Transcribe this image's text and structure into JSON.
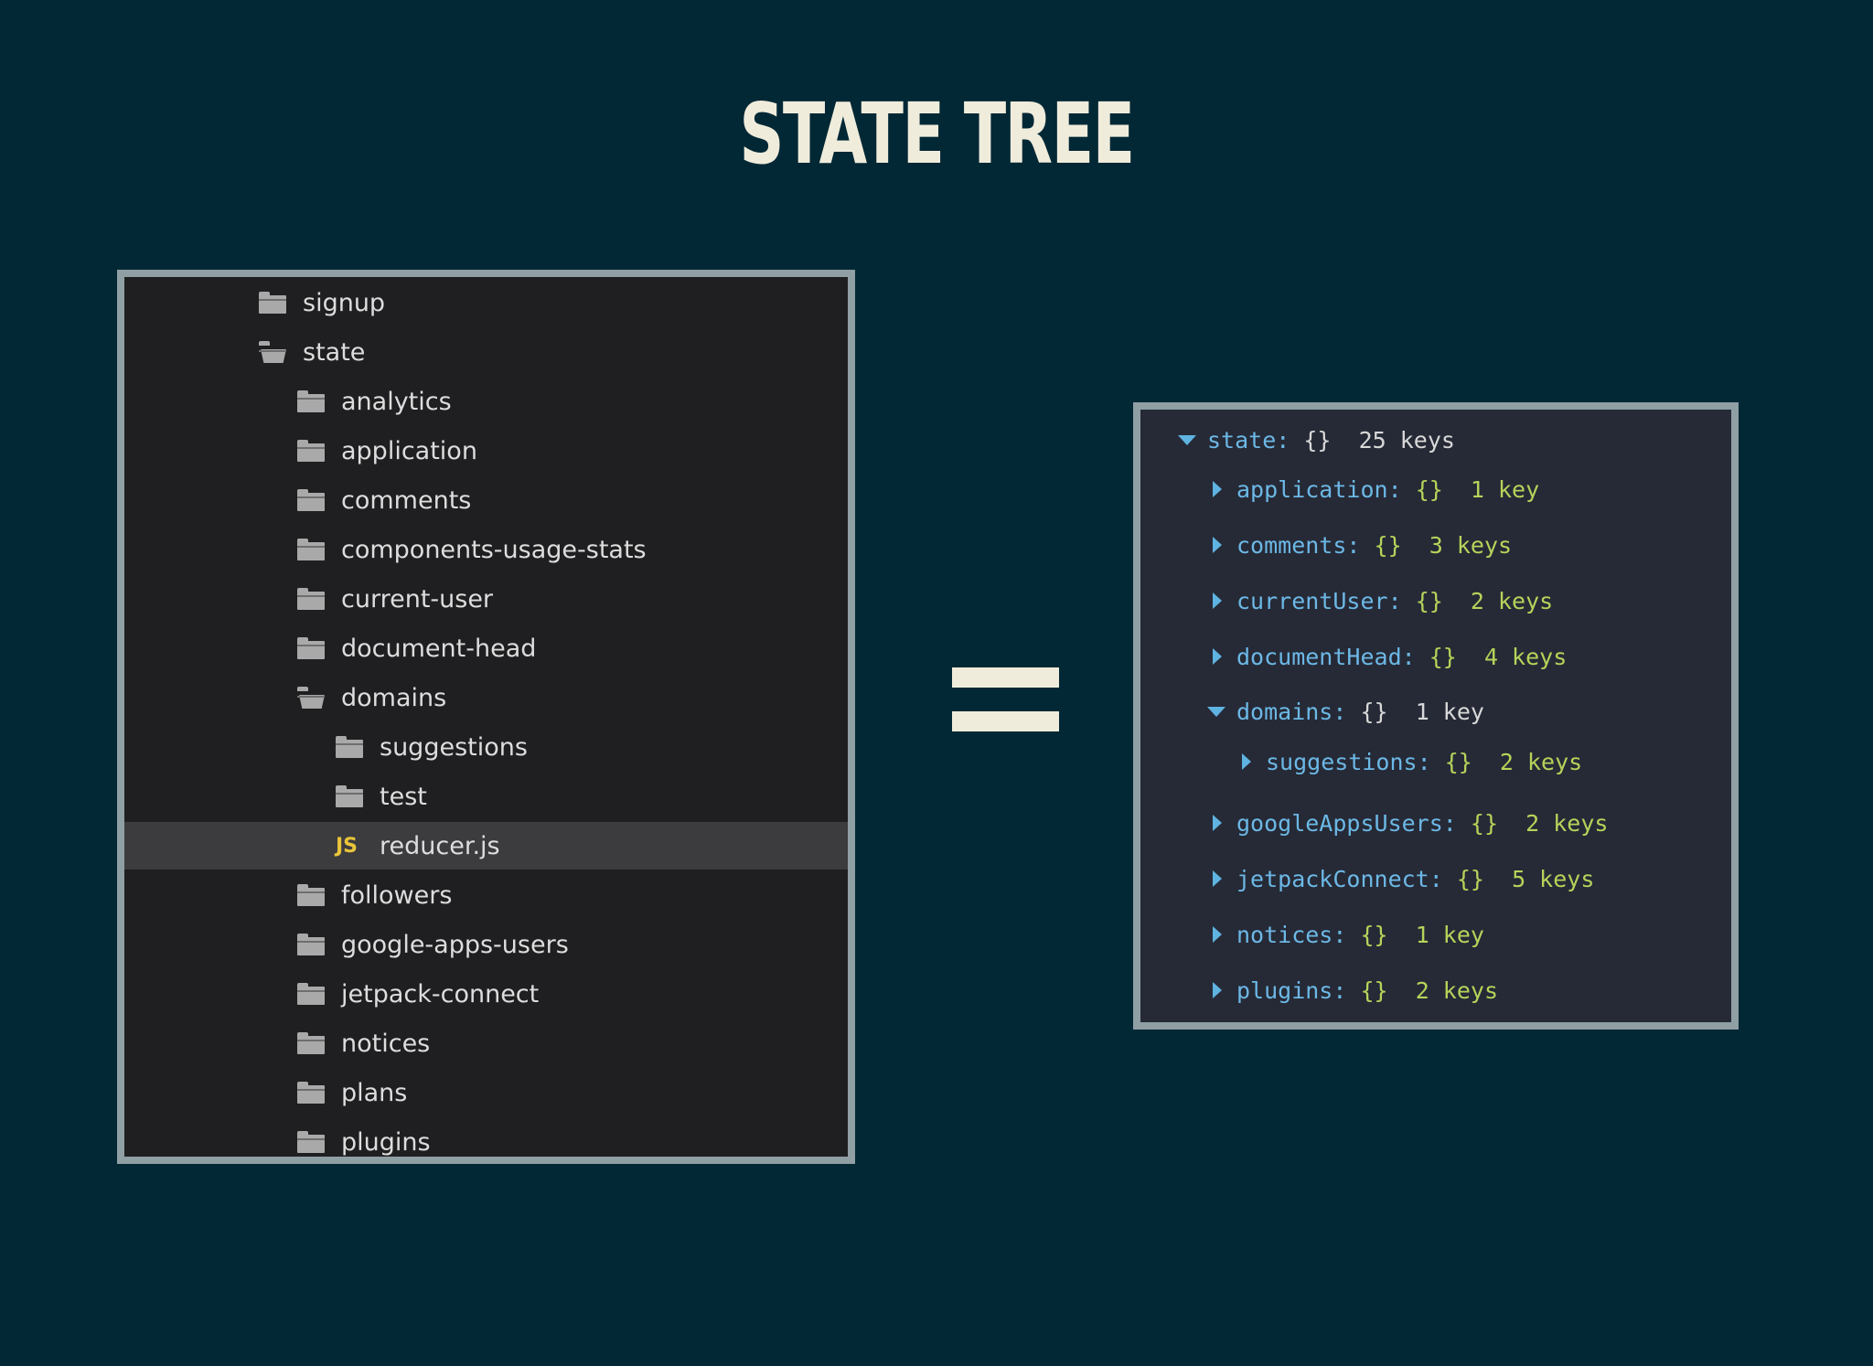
{
  "title": "STATE TREE",
  "file_tree": [
    {
      "name": "signup",
      "type": "folder",
      "open": false
    },
    {
      "name": "state",
      "type": "folder",
      "open": true
    },
    {
      "name": "analytics",
      "type": "folder",
      "open": false
    },
    {
      "name": "application",
      "type": "folder",
      "open": false
    },
    {
      "name": "comments",
      "type": "folder",
      "open": false
    },
    {
      "name": "components-usage-stats",
      "type": "folder",
      "open": false
    },
    {
      "name": "current-user",
      "type": "folder",
      "open": false
    },
    {
      "name": "document-head",
      "type": "folder",
      "open": false
    },
    {
      "name": "domains",
      "type": "folder",
      "open": true
    },
    {
      "name": "suggestions",
      "type": "folder",
      "open": false
    },
    {
      "name": "test",
      "type": "folder",
      "open": false
    },
    {
      "name": "reducer.js",
      "type": "js",
      "icon_label": "JS",
      "selected": true
    },
    {
      "name": "followers",
      "type": "folder",
      "open": false
    },
    {
      "name": "google-apps-users",
      "type": "folder",
      "open": false
    },
    {
      "name": "jetpack-connect",
      "type": "folder",
      "open": false
    },
    {
      "name": "notices",
      "type": "folder",
      "open": false
    },
    {
      "name": "plans",
      "type": "folder",
      "open": false
    },
    {
      "name": "plugins",
      "type": "folder",
      "open": false
    }
  ],
  "state_tree": [
    {
      "key": "state:",
      "braces": "{}",
      "count": "25 keys",
      "expanded": true
    },
    {
      "key": "application:",
      "braces": "{}",
      "count": "1 key",
      "expanded": false
    },
    {
      "key": "comments:",
      "braces": "{}",
      "count": "3 keys",
      "expanded": false
    },
    {
      "key": "currentUser:",
      "braces": "{}",
      "count": "2 keys",
      "expanded": false
    },
    {
      "key": "documentHead:",
      "braces": "{}",
      "count": "4 keys",
      "expanded": false
    },
    {
      "key": "domains:",
      "braces": "{}",
      "count": "1 key",
      "expanded": true
    },
    {
      "key": "suggestions:",
      "braces": "{}",
      "count": "2 keys",
      "expanded": false
    },
    {
      "key": "googleAppsUsers:",
      "braces": "{}",
      "count": "2 keys",
      "expanded": false
    },
    {
      "key": "jetpackConnect:",
      "braces": "{}",
      "count": "5 keys",
      "expanded": false
    },
    {
      "key": "notices:",
      "braces": "{}",
      "count": "1 key",
      "expanded": false
    },
    {
      "key": "plugins:",
      "braces": "{}",
      "count": "2 keys",
      "expanded": false
    }
  ],
  "colors": {
    "background": "#022835",
    "title": "#f0ecdc",
    "key": "#6cb8e6",
    "value": "#b6d35a",
    "js_icon": "#e8c53a"
  }
}
